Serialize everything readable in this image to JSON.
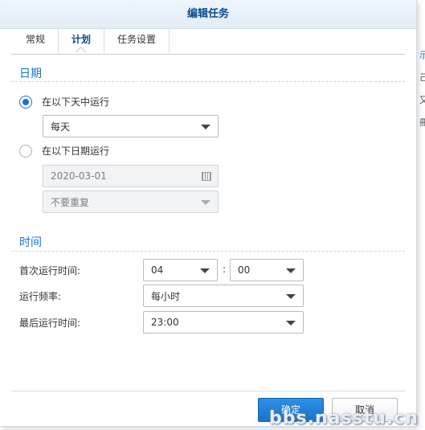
{
  "dialog": {
    "title": "编辑任务"
  },
  "tabs": [
    {
      "label": "常规",
      "active": false
    },
    {
      "label": "计划",
      "active": true
    },
    {
      "label": "任务设置",
      "active": false
    }
  ],
  "date_section": {
    "title": "日期",
    "option_daily": {
      "label": "在以下天中运行",
      "checked": true
    },
    "daily_select": {
      "value": "每天"
    },
    "option_date": {
      "label": "在以下日期运行",
      "checked": false
    },
    "date_input": {
      "value": "2020-03-01",
      "icon": "calendar-icon"
    },
    "repeat_select": {
      "value": "不要重复"
    }
  },
  "time_section": {
    "title": "时间",
    "first_run_label": "首次运行时间:",
    "hour_select": {
      "value": "04"
    },
    "colon": ":",
    "minute_select": {
      "value": "00"
    },
    "frequency_label": "运行频率:",
    "frequency_select": {
      "value": "每小时"
    },
    "last_run_label": "最后运行时间:",
    "last_run_select": {
      "value": "23:00"
    }
  },
  "footer": {
    "ok_label": "确定",
    "cancel_label": "取消"
  },
  "background_glyphs": [
    "示",
    "己",
    "又",
    "冊"
  ],
  "watermark": "bbs.nasstu.cn",
  "colors": {
    "accent": "#1a73c8",
    "title_text": "#0b4c8c",
    "primary_button": "#1a73c8"
  }
}
